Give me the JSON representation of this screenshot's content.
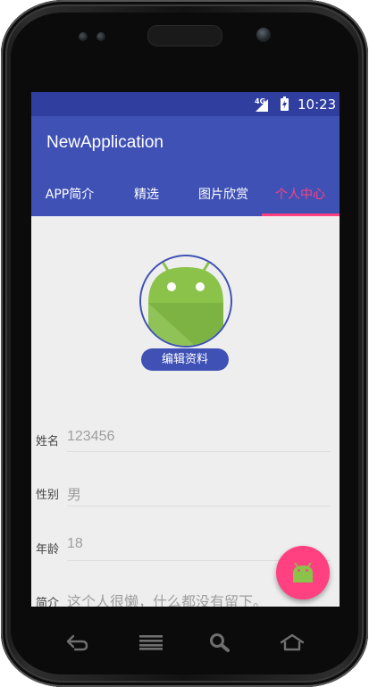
{
  "status_bar": {
    "network": "4G",
    "time": "10:23"
  },
  "app": {
    "title": "NewApplication"
  },
  "tabs": [
    {
      "label": "APP简介",
      "active": false
    },
    {
      "label": "精选",
      "active": false
    },
    {
      "label": "图片欣赏",
      "active": false
    },
    {
      "label": "个人中心",
      "active": true
    }
  ],
  "profile": {
    "edit_button": "编辑资料",
    "fields": [
      {
        "label": "姓名",
        "value": "123456"
      },
      {
        "label": "性别",
        "value": "男"
      },
      {
        "label": "年龄",
        "value": "18"
      },
      {
        "label": "简介",
        "value": "这个人很懒，什么都没有留下。"
      }
    ]
  },
  "colors": {
    "primary": "#3f51b5",
    "primary_dark": "#303f9f",
    "accent": "#ff4081",
    "background": "#eeeeee",
    "android_green": "#8bc34a"
  },
  "nav_keys": [
    "back-icon",
    "menu-icon",
    "search-icon",
    "home-icon"
  ]
}
